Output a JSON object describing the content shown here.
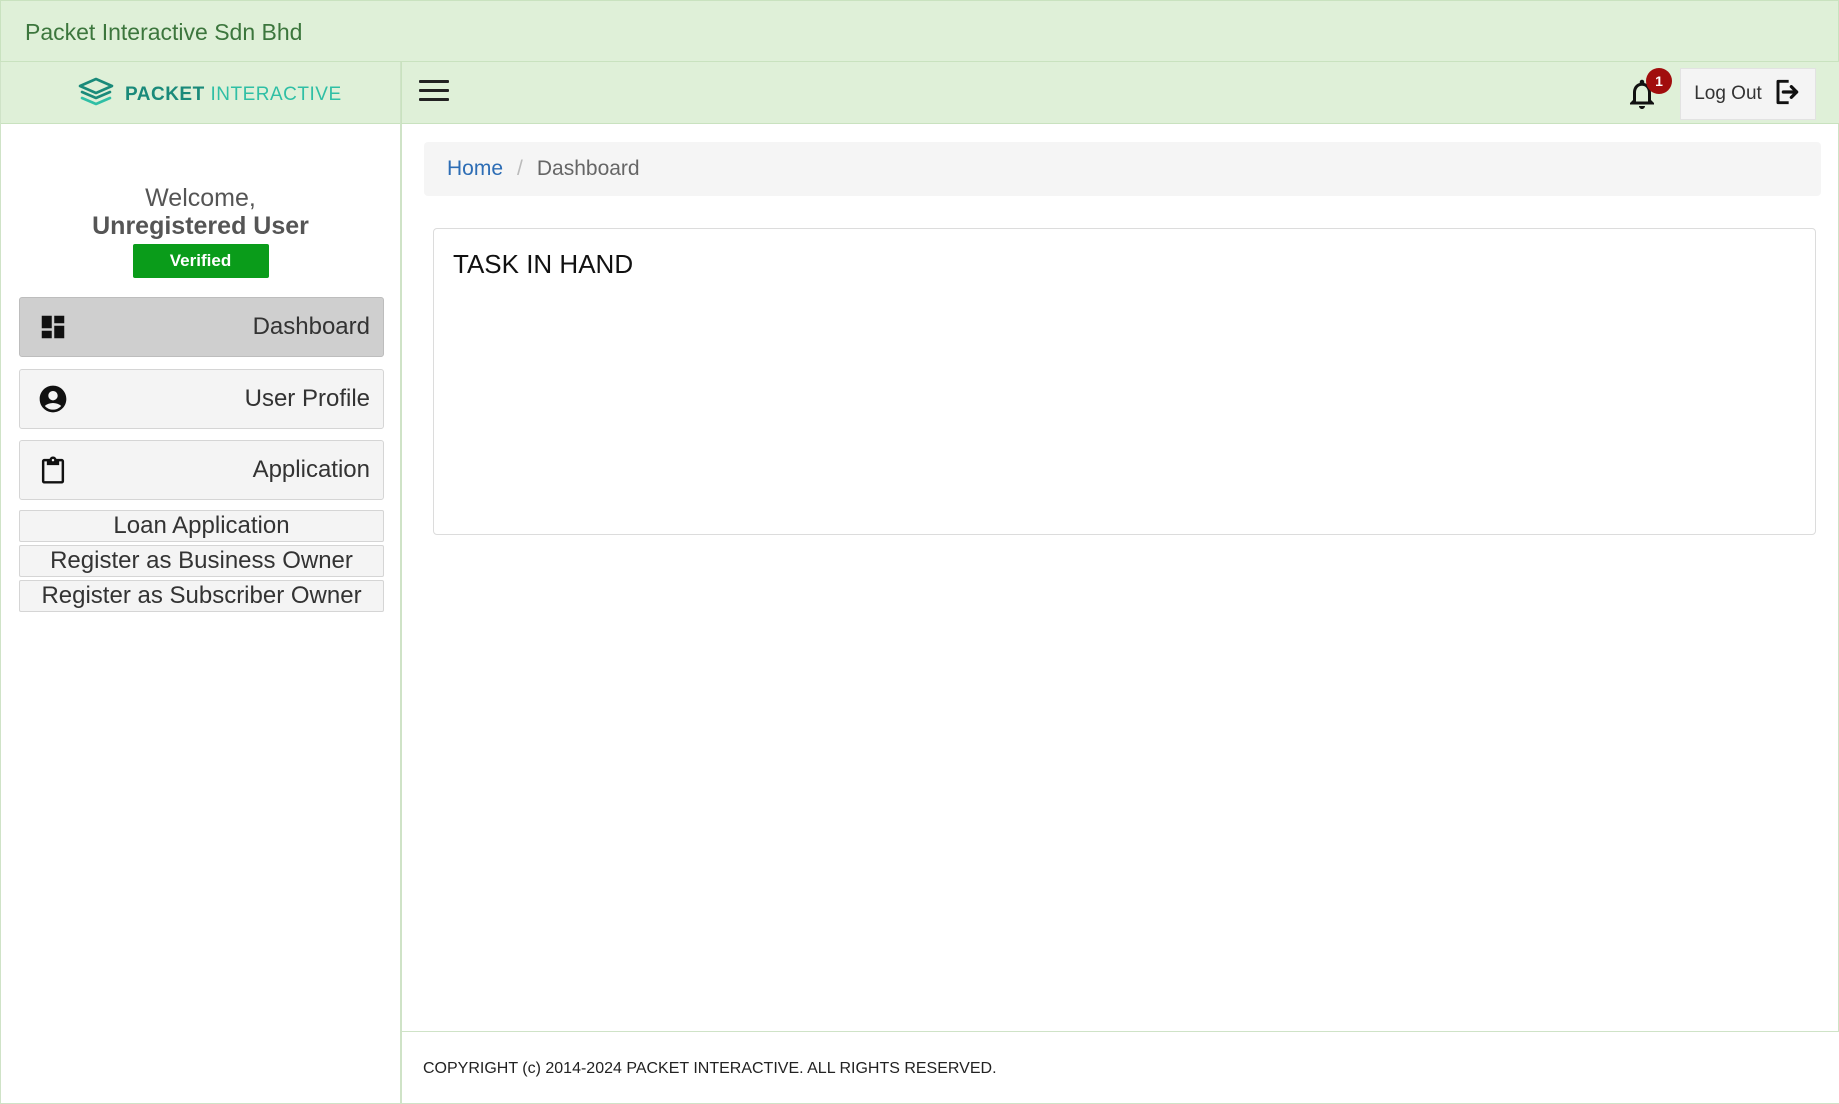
{
  "header": {
    "company_name": "Packet Interactive Sdn Bhd"
  },
  "brand": {
    "part1": "PACKET",
    "part2": "INTERACTIVE"
  },
  "user": {
    "welcome": "Welcome,",
    "name": "Unregistered User",
    "status": "Verified"
  },
  "sidebar": {
    "items": [
      {
        "label": "Dashboard",
        "icon": "dashboard-icon",
        "active": true
      },
      {
        "label": "User Profile",
        "icon": "account-circle-icon"
      },
      {
        "label": "Application",
        "icon": "clipboard-icon"
      }
    ],
    "sub_items": [
      {
        "label": "Loan Application"
      },
      {
        "label": "Register as Business Owner"
      },
      {
        "label": "Register as Subscriber Owner"
      }
    ]
  },
  "topbar": {
    "notification_count": "1",
    "logout_label": "Log Out"
  },
  "breadcrumb": {
    "home": "Home",
    "separator": "/",
    "current": "Dashboard"
  },
  "panel": {
    "title": "TASK IN HAND"
  },
  "footer": {
    "copyright": "COPYRIGHT (c) 2014-2024 PACKET INTERACTIVE. ALL RIGHTS RESERVED."
  },
  "colors": {
    "header_bg": "#dff0d8",
    "verified": "#0a9c1a",
    "badge": "#a10d0d",
    "link": "#2d6db5",
    "brand": "#1a8a7a"
  }
}
